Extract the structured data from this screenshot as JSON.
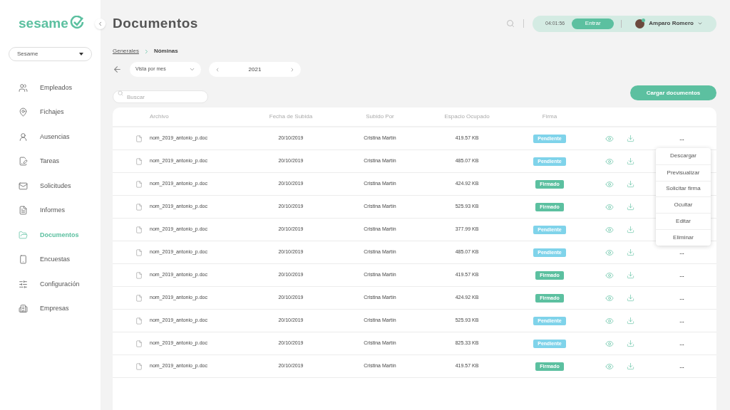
{
  "sidebar": {
    "logo": "sesame",
    "company_select": "Sesame",
    "items": [
      {
        "label": "Empleados",
        "selected": false
      },
      {
        "label": "Fichajes",
        "selected": false
      },
      {
        "label": "Ausencias",
        "selected": false
      },
      {
        "label": "Tareas",
        "selected": false
      },
      {
        "label": "Solicitudes",
        "selected": false
      },
      {
        "label": "Informes",
        "selected": false
      },
      {
        "label": "Documentos",
        "selected": true
      },
      {
        "label": "Encuestas",
        "selected": false
      },
      {
        "label": "Configuración",
        "selected": false
      },
      {
        "label": "Empresas",
        "selected": false
      }
    ]
  },
  "header": {
    "title": "Documentos",
    "timer": "04:01:56",
    "enter_button": "Entrar",
    "user": "Amparo Romero"
  },
  "breadcrumb": [
    "Generales",
    "Nóminas"
  ],
  "view_select": "Vista por mes",
  "year": "2021",
  "search": {
    "placeholder": "Buscar"
  },
  "upload_button": "Cargar documentos",
  "table": {
    "columns": [
      "Archivo",
      "Fecha de Subida",
      "Subido Por",
      "Espacio Ocupado",
      "Firma"
    ],
    "rows": [
      {
        "file": "nom_2019_antonio_p.doc",
        "date": "20/10/2019",
        "by": "Cristina Martín",
        "size": "419.57 KB",
        "status": {
          "label": "Pendiente",
          "kind": "pending"
        },
        "more": "..."
      },
      {
        "file": "nom_2019_antonio_p.doc",
        "date": "20/10/2019",
        "by": "Cristina Martín",
        "size": "485.07 KB",
        "status": {
          "label": "Pendiente",
          "kind": "pending"
        }
      },
      {
        "file": "nom_2019_antonio_p.doc",
        "date": "20/10/2019",
        "by": "Cristina Martín",
        "size": "424.92 KB",
        "status": {
          "label": "Firmado",
          "kind": "signed"
        }
      },
      {
        "file": "nom_2019_antonio_p.doc",
        "date": "20/10/2019",
        "by": "Cristina Martín",
        "size": "525.93 KB",
        "status": {
          "label": "Firmado",
          "kind": "signed"
        }
      },
      {
        "file": "nom_2019_antonio_p.doc",
        "date": "20/10/2019",
        "by": "Cristina Martín",
        "size": "377.99 KB",
        "status": {
          "label": "Pendiente",
          "kind": "pending"
        }
      },
      {
        "file": "nom_2019_antonio_p.doc",
        "date": "20/10/2019",
        "by": "Cristina Martín",
        "size": "485.07 KB",
        "status": {
          "label": "Pendiente",
          "kind": "pending"
        },
        "more": "..."
      },
      {
        "file": "nom_2019_antonio_p.doc",
        "date": "20/10/2019",
        "by": "Cristina Martín",
        "size": "419.57 KB",
        "status": {
          "label": "Firmado",
          "kind": "signed"
        },
        "more": "..."
      },
      {
        "file": "nom_2019_antonio_p.doc",
        "date": "20/10/2019",
        "by": "Cristina Martín",
        "size": "424.92 KB",
        "status": {
          "label": "Firmado",
          "kind": "signed"
        },
        "more": "..."
      },
      {
        "file": "nom_2019_antonio_p.doc",
        "date": "20/10/2019",
        "by": "Cristina Martín",
        "size": "525.93 KB",
        "status": {
          "label": "Pendiente",
          "kind": "pending"
        },
        "more": "..."
      },
      {
        "file": "nom_2019_antonio_p.doc",
        "date": "20/10/2019",
        "by": "Cristina Martín",
        "size": "825.33 KB",
        "status": {
          "label": "Pendiente",
          "kind": "pending"
        },
        "more": "..."
      },
      {
        "file": "nom_2019_antonio_p.doc",
        "date": "20/10/2019",
        "by": "Cristina Martín",
        "size": "419.57 KB",
        "status": {
          "label": "Firmado",
          "kind": "signed"
        },
        "more": "..."
      }
    ]
  },
  "context_menu": [
    "Descargar",
    "Previsualizar",
    "Solicitar firma",
    "Ocultar",
    "Editar",
    "Eliminar"
  ]
}
